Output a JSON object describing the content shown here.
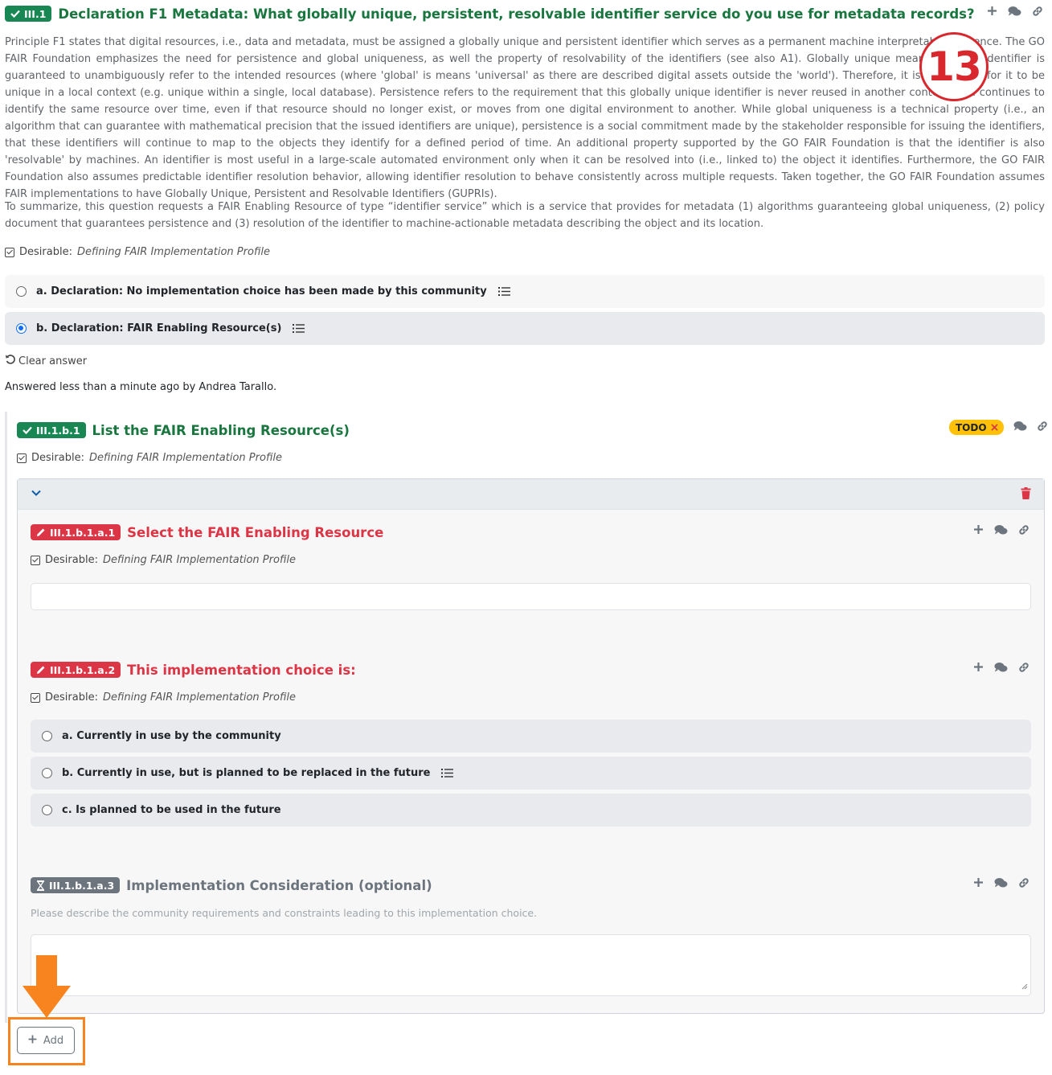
{
  "question": {
    "id": "III.1",
    "title": "Declaration F1 Metadata: What globally unique, persistent, resolvable identifier service do you use for metadata records?",
    "description_1": "Principle F1 states that digital resources, i.e., data and metadata, must be assigned a globally unique and persistent identifier which serves as a permanent machine interpretable reference. The GO FAIR Foundation emphasizes the need for persistence and global uniqueness, as well the property of resolvability of the identifiers (see also A1). Globally unique means that the identifier is guaranteed to unambiguously refer to the intended resources (where 'global' is means 'universal' as there are described digital assets outside the 'world'). Therefore, it is insufficient for it to be unique in a local context (e.g. unique within a single, local database). Persistence refers to the requirement that this globally unique identifier is never reused in another context, and continues to identify the same resource over time, even if that resource should no longer exist, or moves from one digital environment to another. While global uniqueness is a technical property (i.e., an algorithm that can guarantee with mathematical precision that the issued identifiers are unique), persistence is a social commitment made by the stakeholder responsible for issuing the identifiers, that these identifiers will continue to map to the objects they identify for a defined period of time. An additional property supported by the GO FAIR Foundation is that the identifier is also 'resolvable' by machines. An identifier is most useful in a large-scale automated environment only when it can be resolved into (i.e., linked to) the object it identifies. Furthermore, the GO FAIR Foundation also assumes predictable identifier resolution behavior, allowing identifier resolution to behave consistently across multiple requests. Taken together, the GO FAIR Foundation assumes FAIR implementations to have Globally Unique, Persistent and Resolvable Identifiers (GUPRIs).",
    "description_2": "To summarize, this question requests a FAIR Enabling Resource of type “identifier service” which is a service that provides for metadata (1) algorithms guaranteeing global uniqueness, (2) policy document that guarantees persistence and (3) resolution of the identifier to machine-actionable metadata describing the object and its location.",
    "desirable_label": "Desirable:",
    "desirable_value": "Defining FAIR Implementation Profile",
    "options": [
      {
        "label": "a. Declaration: No implementation choice has been made by this community",
        "selected": false
      },
      {
        "label": "b. Declaration: FAIR Enabling Resource(s)",
        "selected": true
      }
    ],
    "clear_answer": "Clear answer",
    "answered_by": "Answered less than a minute ago by Andrea Tarallo."
  },
  "subquestion": {
    "id": "III.1.b.1",
    "title": "List the FAIR Enabling Resource(s)",
    "todo": "TODO",
    "desirable_label": "Desirable:",
    "desirable_value": "Defining FAIR Implementation Profile",
    "items": [
      {
        "id": "III.1.b.1.a.1",
        "title": "Select the FAIR Enabling Resource",
        "desirable_label": "Desirable:",
        "desirable_value": "Defining FAIR Implementation Profile",
        "value": ""
      },
      {
        "id": "III.1.b.1.a.2",
        "title": "This implementation choice is:",
        "desirable_label": "Desirable:",
        "desirable_value": "Defining FAIR Implementation Profile",
        "options": [
          {
            "label": "a. Currently in use by the community",
            "selected": false
          },
          {
            "label": "b. Currently in use, but is planned to be replaced in the future",
            "selected": false
          },
          {
            "label": "c. Is planned to be used in the future",
            "selected": false
          }
        ]
      },
      {
        "id": "III.1.b.1.a.3",
        "title": "Implementation Consideration (optional)",
        "hint": "Please describe the community requirements and constraints leading to this implementation choice.",
        "value": ""
      }
    ],
    "add_label": "Add"
  },
  "annotation": {
    "step_number": "13"
  },
  "colors": {
    "answered": "#198754",
    "required": "#dc3545",
    "optional": "#6c757d",
    "todo": "#ffc107",
    "highlight": "#f7841f",
    "annotation": "#d9272e"
  },
  "icons": {
    "answered": "check-icon",
    "required": "pencil-icon",
    "optional": "hourglass-icon",
    "add": "plus-icon",
    "comments": "comments-icon",
    "link": "link-icon",
    "delete": "trash-icon",
    "collapse": "chevron-down-icon",
    "undo": "undo-icon",
    "details": "list-icon",
    "pointer": "arrow-down-icon"
  }
}
